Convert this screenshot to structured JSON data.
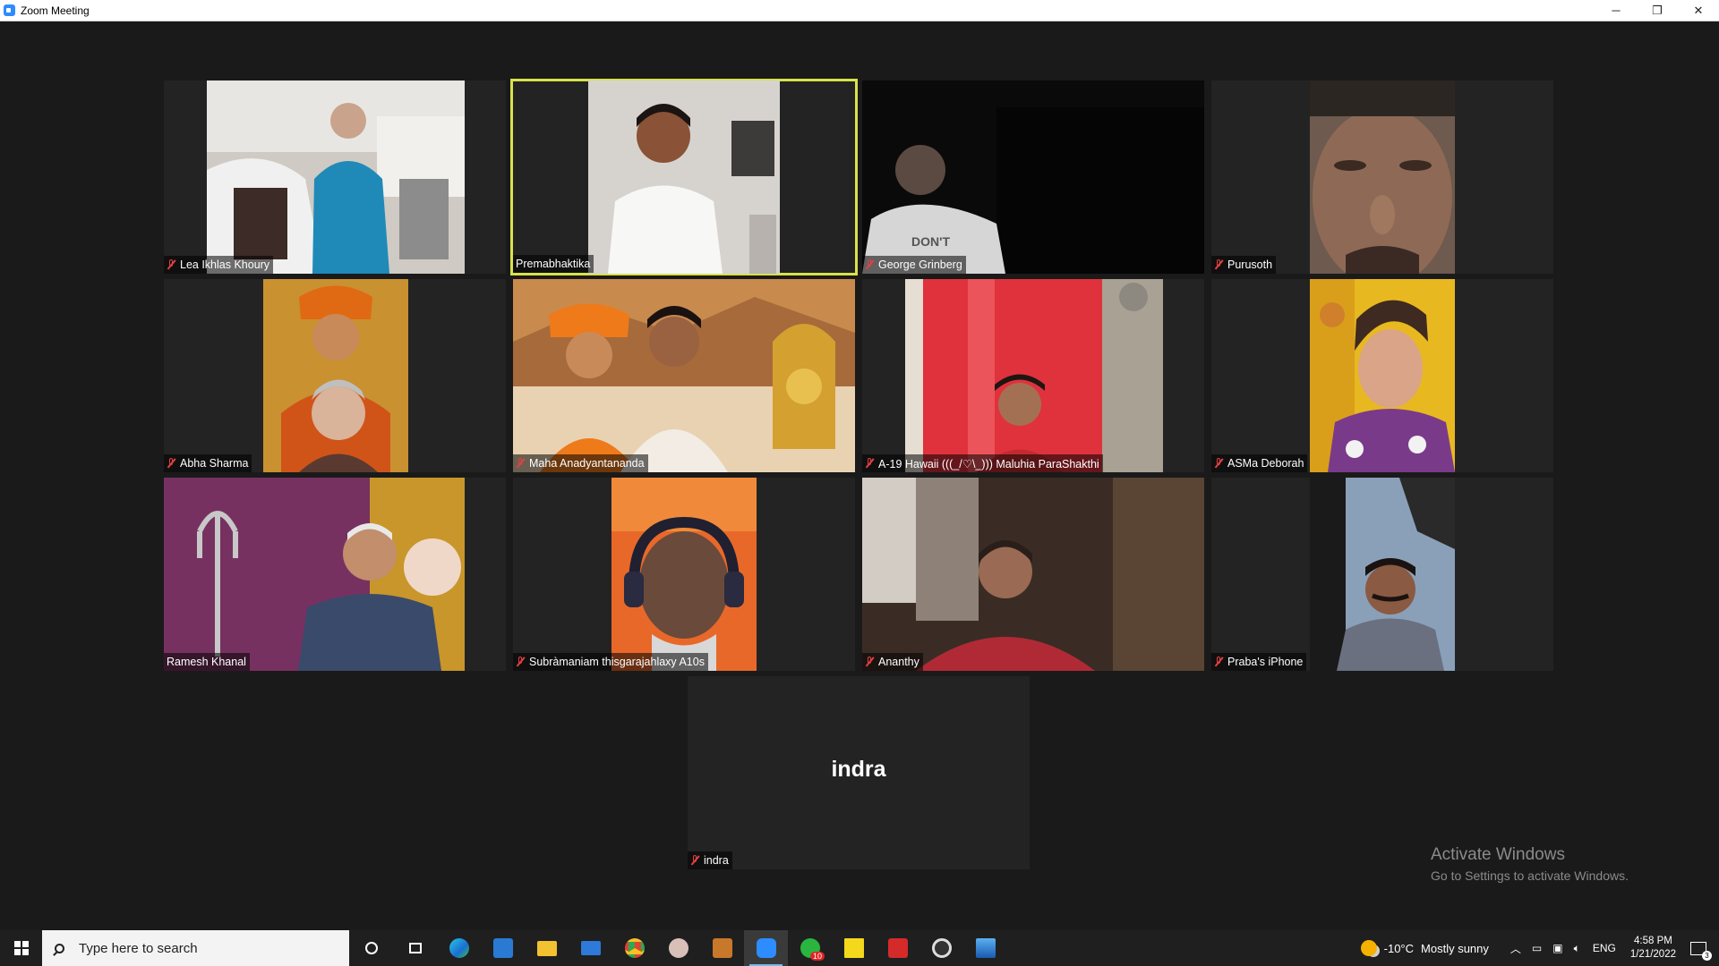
{
  "window": {
    "title": "Zoom Meeting",
    "min": "─",
    "max": "❐",
    "close": "✕"
  },
  "participants": [
    {
      "name": "Lea Ikhlas Khoury",
      "muted": true
    },
    {
      "name": "Premabhaktika",
      "muted": false
    },
    {
      "name": "George Grinberg",
      "muted": true
    },
    {
      "name": "Purusoth",
      "muted": true
    },
    {
      "name": "Abha Sharma",
      "muted": true
    },
    {
      "name": "Maha Anadyantananda",
      "muted": true
    },
    {
      "name": "A-19 Hawaii (((_/♡\\_))) Maluhia ParaShakthi",
      "muted": true
    },
    {
      "name": "ASMa Deborah",
      "muted": true
    },
    {
      "name": "Ramesh Khanal",
      "muted": false
    },
    {
      "name": "Subràmaniam thisgarajahlaxy A10s",
      "muted": true
    },
    {
      "name": "Ananthy",
      "muted": true
    },
    {
      "name": "Praba's iPhone",
      "muted": true
    },
    {
      "name": "indra",
      "muted": true,
      "no_video_label": "indra"
    }
  ],
  "watermark": {
    "line1": "Activate Windows",
    "line2": "Go to Settings to activate Windows."
  },
  "taskbar": {
    "search_placeholder": "Type here to search",
    "whatsapp_badge": "10",
    "weather": {
      "temp": "-10°C",
      "condition": "Mostly sunny"
    },
    "language": "ENG",
    "time": "4:58 PM",
    "date": "1/21/2022",
    "notifications": "3"
  }
}
